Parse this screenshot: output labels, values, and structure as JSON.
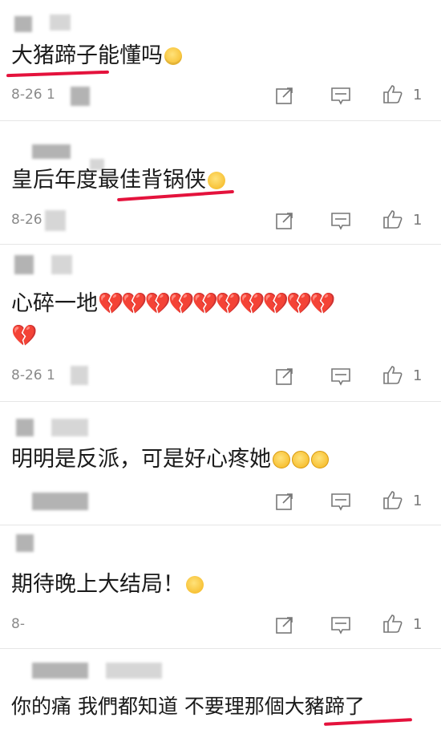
{
  "comments": [
    {
      "text": "大猪蹄子能懂吗",
      "date": "8-26 1",
      "likes": "1",
      "emoji": "crying-face"
    },
    {
      "text": "皇后年度最佳背锅侠",
      "date": "8-26",
      "likes": "1",
      "emoji": "laughing-tears-face"
    },
    {
      "text": "心碎一地",
      "date": "8-26 1",
      "likes": "1",
      "emoji": "broken-heart",
      "emoji_glyph": "💔"
    },
    {
      "text": "明明是反派，可是好心疼她",
      "date": "",
      "likes": "1",
      "emoji": "pleading-face"
    },
    {
      "text": "期待晚上大结局！",
      "date": "8-",
      "likes": "1",
      "emoji": "nervous-face"
    },
    {
      "text": "你的痛 我們都知道 不要理那個大豬蹄了"
    }
  ],
  "colors": {
    "underline": "#e4123c",
    "icon": "#777777",
    "text": "#1a1a1a",
    "meta": "#8a8a8a"
  }
}
